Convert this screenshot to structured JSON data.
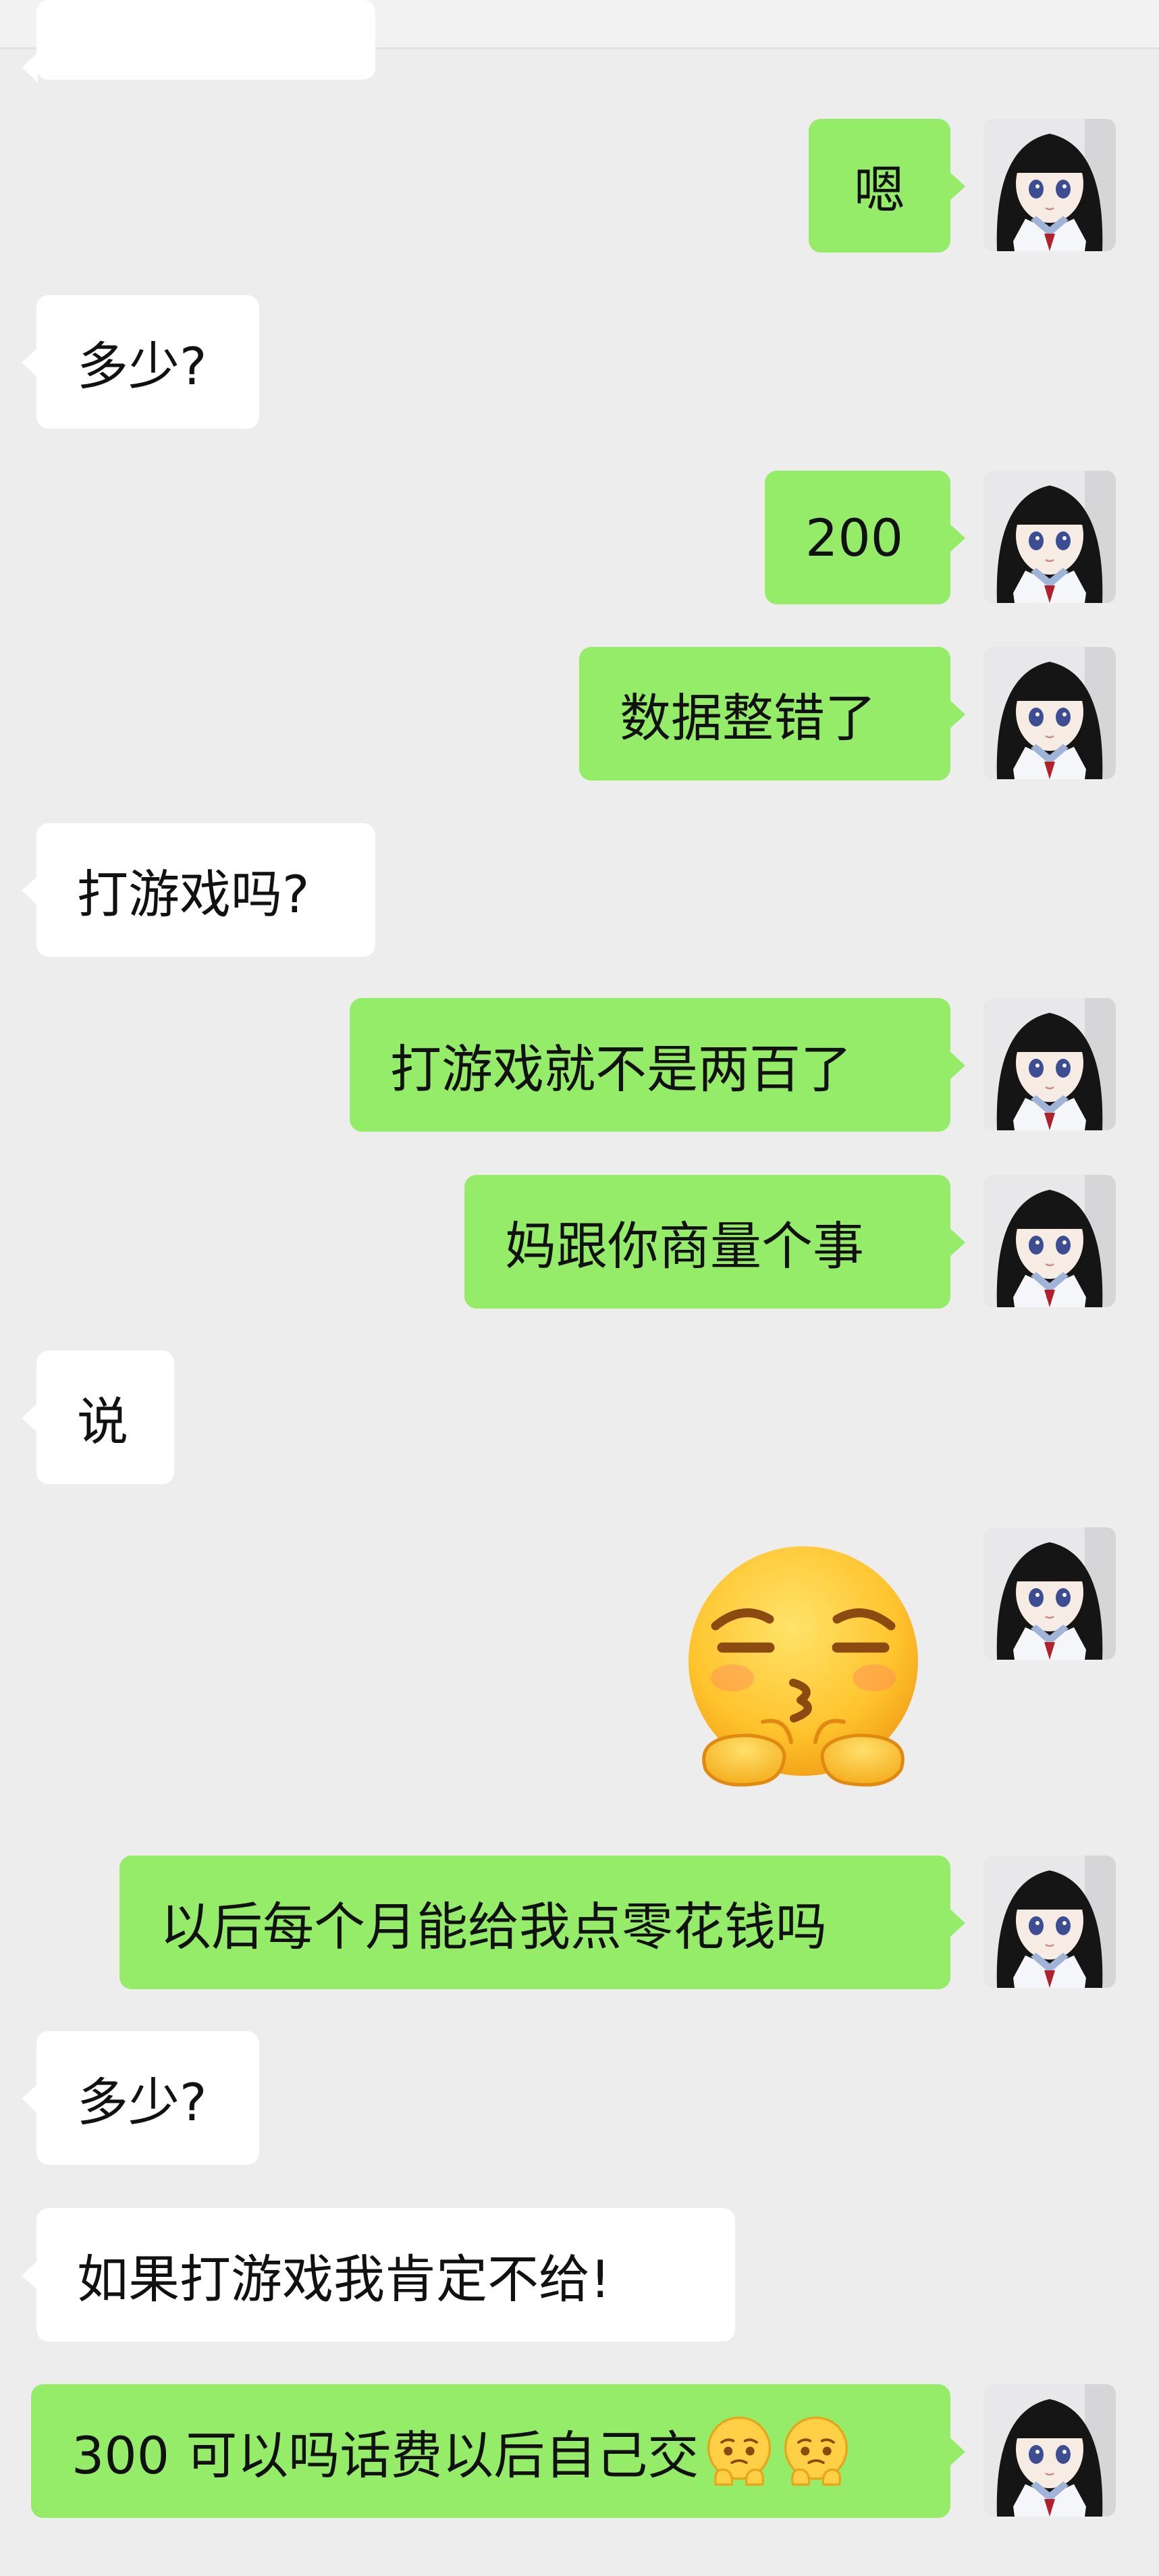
{
  "messages": [
    {
      "side": "in",
      "text": ""
    },
    {
      "side": "out",
      "text": "嗯"
    },
    {
      "side": "in",
      "text": "多少?"
    },
    {
      "side": "out",
      "text": "200"
    },
    {
      "side": "out",
      "text": "数据整错了"
    },
    {
      "side": "in",
      "text": "打游戏吗?"
    },
    {
      "side": "out",
      "text": "打游戏就不是两百了"
    },
    {
      "side": "out",
      "text": "妈跟你商量个事"
    },
    {
      "side": "in",
      "text": "说"
    },
    {
      "side": "out",
      "text": "",
      "sticker": "blowing-kiss-hands-emoji-sticker"
    },
    {
      "side": "out",
      "text": "以后每个月能给我点零花钱吗"
    },
    {
      "side": "in",
      "text": "多少?"
    },
    {
      "side": "in",
      "text": "如果打游戏我肯定不给!"
    },
    {
      "side": "out",
      "text": "300 可以吗话费以后自己交",
      "emojis": [
        "pleading-face-emoji",
        "pleading-face-emoji"
      ]
    }
  ],
  "avatar": {
    "icon": "doll-girl-avatar"
  },
  "colors": {
    "background": "#ededed",
    "incoming_bubble": "#ffffff",
    "outgoing_bubble": "#95ec69",
    "text": "#111111"
  }
}
